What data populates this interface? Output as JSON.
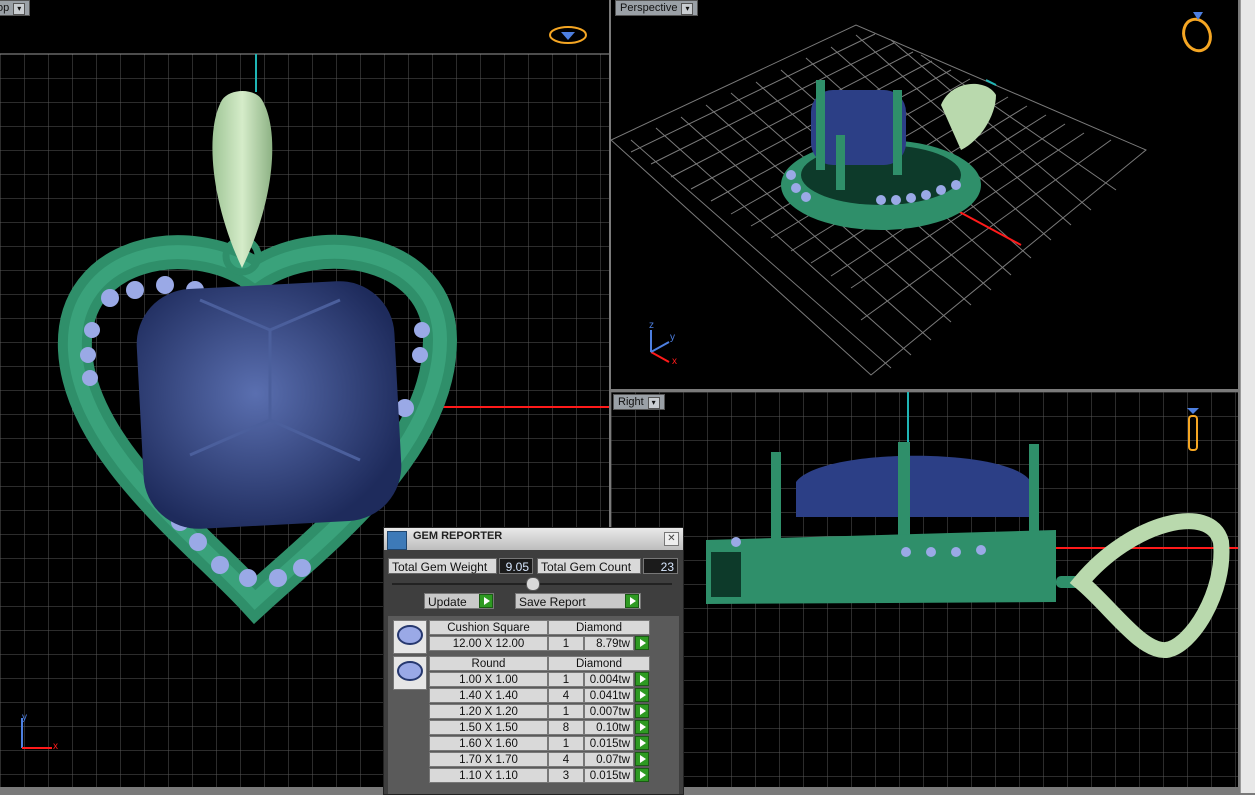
{
  "viewports": {
    "top": {
      "label": "op"
    },
    "perspective": {
      "label": "Perspective"
    },
    "right": {
      "label": "Right"
    }
  },
  "axes": {
    "x": "x",
    "y": "y",
    "z": "z"
  },
  "gem_reporter": {
    "title": "GEM REPORTER",
    "total_weight_label": "Total Gem Weight",
    "total_weight_value": "9.05",
    "total_count_label": "Total Gem Count",
    "total_count_value": "23",
    "update_label": "Update",
    "save_report_label": "Save Report",
    "groups": [
      {
        "shape": "Cushion Square",
        "material": "Diamond",
        "rows": [
          {
            "size": "12.00 X 12.00",
            "count": "1",
            "weight": "8.79tw"
          }
        ]
      },
      {
        "shape": "Round",
        "material": "Diamond",
        "rows": [
          {
            "size": "1.00 X 1.00",
            "count": "1",
            "weight": "0.004tw"
          },
          {
            "size": "1.40 X 1.40",
            "count": "4",
            "weight": "0.041tw"
          },
          {
            "size": "1.20 X 1.20",
            "count": "1",
            "weight": "0.007tw"
          },
          {
            "size": "1.50 X 1.50",
            "count": "8",
            "weight": "0.10tw"
          },
          {
            "size": "1.60 X 1.60",
            "count": "1",
            "weight": "0.015tw"
          },
          {
            "size": "1.70 X 1.70",
            "count": "4",
            "weight": "0.07tw"
          },
          {
            "size": "1.10 X 1.10",
            "count": "3",
            "weight": "0.015tw"
          }
        ]
      }
    ]
  },
  "colors": {
    "metal": "#2f8f6a",
    "bail": "#b9d9ad",
    "gem": "#26386f",
    "accent_gem": "#9aa9e6",
    "axis_red": "#ff1a1a",
    "axis_cyan": "#1fb5b5"
  }
}
